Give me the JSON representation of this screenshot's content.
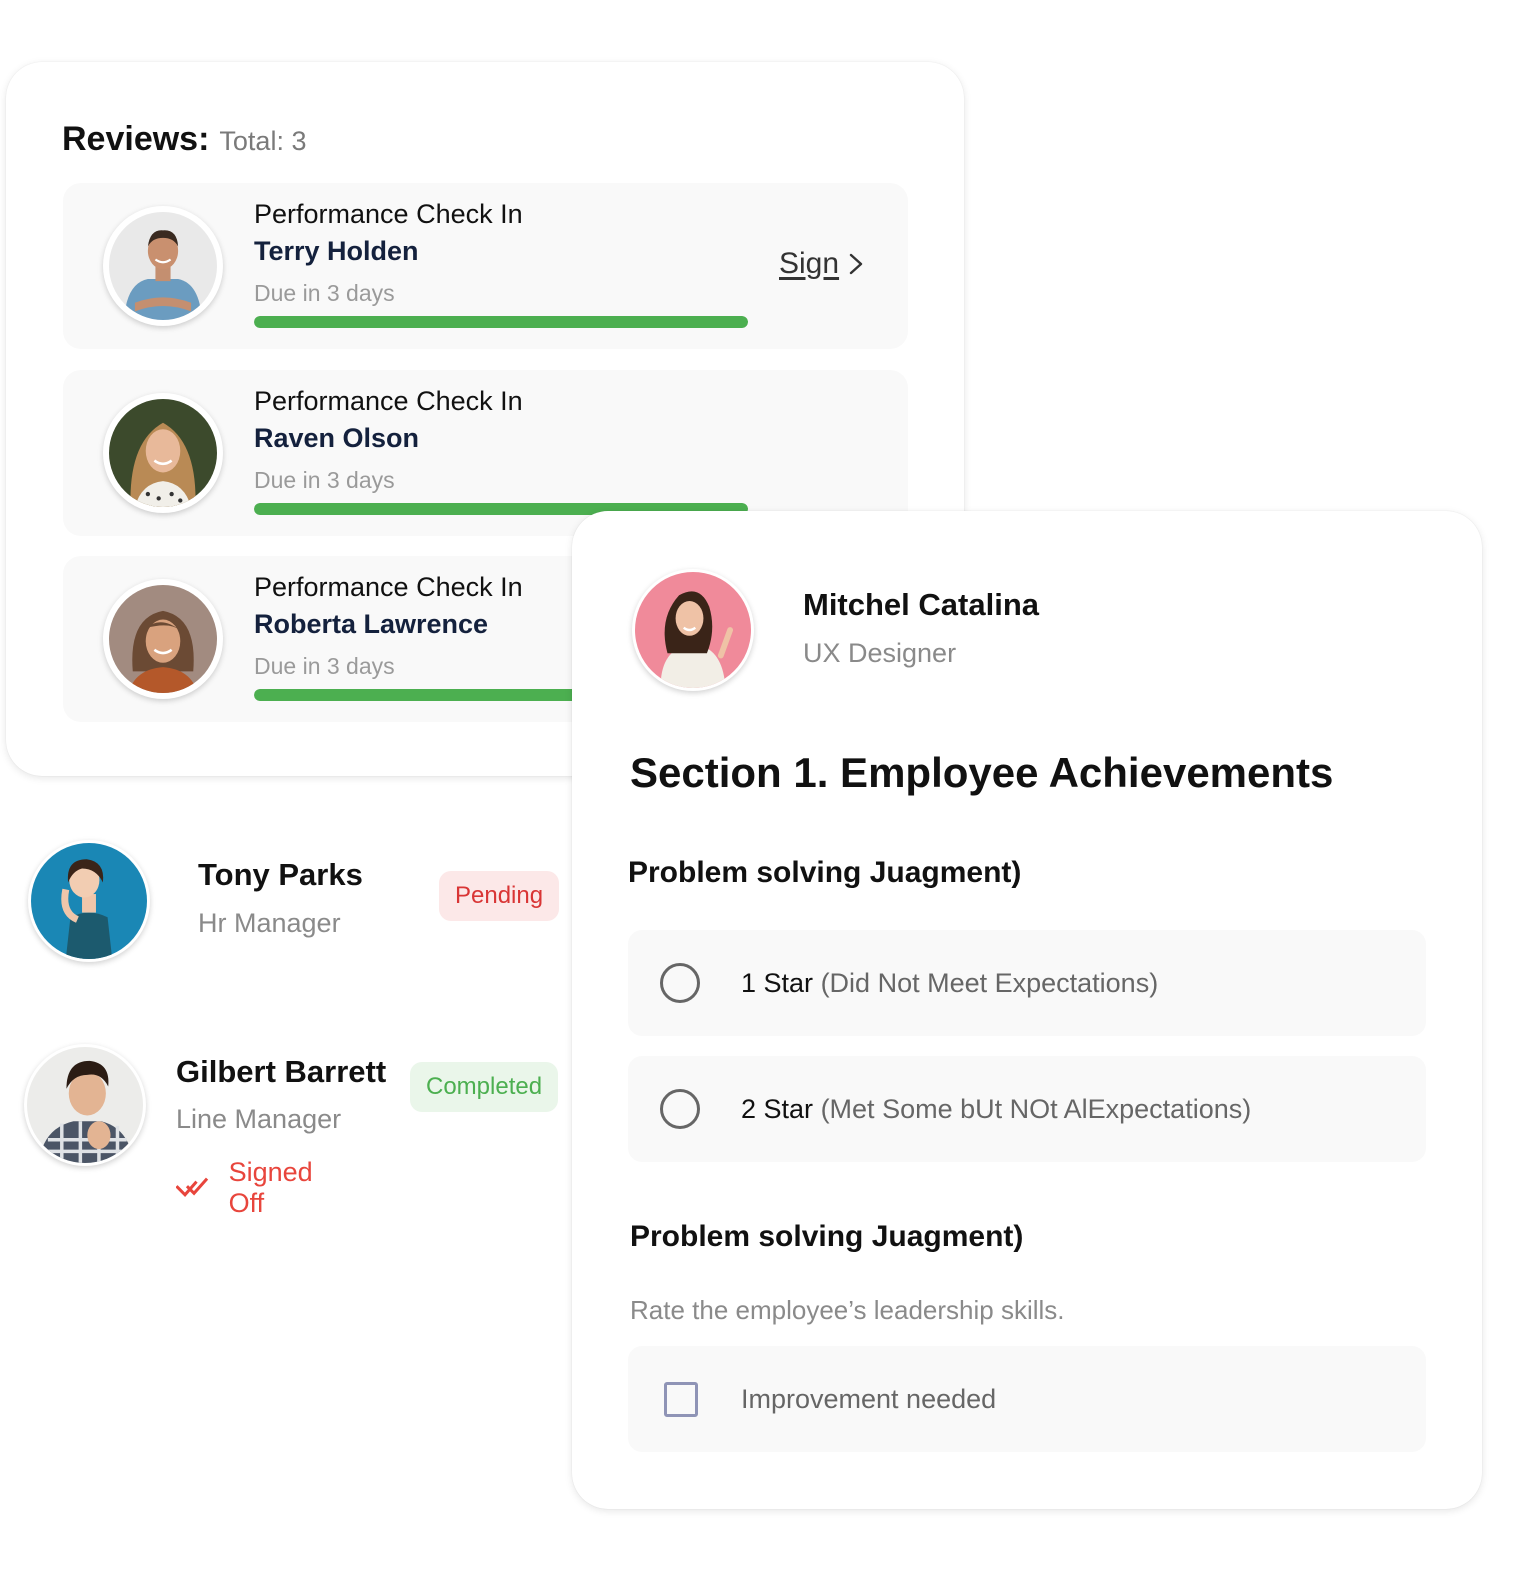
{
  "reviews": {
    "title": "Reviews:",
    "total_label": "Total: 3",
    "items": [
      {
        "type": "Performance Check In",
        "name": "Terry Holden",
        "due": "Due in 3 days",
        "progress_percent": 100,
        "action_label": "Sign",
        "avatar": "avatar-terry-holden"
      },
      {
        "type": "Performance Check In",
        "name": "Raven Olson",
        "due": "Due in 3 days",
        "progress_percent": 100,
        "avatar": "avatar-raven-olson"
      },
      {
        "type": "Performance Check In",
        "name": "Roberta Lawrence",
        "due": "Due in 3 days",
        "progress_percent": 100,
        "avatar": "avatar-roberta-lawrence"
      }
    ]
  },
  "approvers": [
    {
      "name": "Tony Parks",
      "role": "Hr Manager",
      "status": "Pending",
      "avatar": "avatar-tony-parks"
    },
    {
      "name": "Gilbert Barrett",
      "role": "Line Manager",
      "status": "Completed",
      "signed_off_label": "Signed Off",
      "signed_off_icon": "double-check-icon",
      "avatar": "avatar-gilbert-barrett"
    }
  ],
  "evaluation": {
    "employee": {
      "name": "Mitchel Catalina",
      "role": "UX Designer",
      "avatar": "avatar-mitchel-catalina"
    },
    "section_title": "Section 1. Employee Achievements",
    "questions": [
      {
        "title": "Problem solving Juagment)",
        "input_type": "radio",
        "options": [
          {
            "label": "1 Star",
            "note": "(Did Not Meet Expectations)",
            "selected": false
          },
          {
            "label": "2 Star",
            "note": "(Met Some bUt NOt AlExpectations)",
            "selected": false
          }
        ]
      },
      {
        "title": "Problem solving Juagment)",
        "description": "Rate the employee’s leadership skills.",
        "input_type": "checkbox",
        "options": [
          {
            "label": "Improvement needed",
            "checked": false
          }
        ]
      }
    ]
  },
  "colors": {
    "progress": "#4caf50",
    "pending_text": "#d93535",
    "pending_bg": "#fce8e8",
    "completed_text": "#4caf50",
    "completed_bg": "#eaf6ea",
    "signed_off": "#e8453c",
    "name_navy": "#14213d"
  }
}
